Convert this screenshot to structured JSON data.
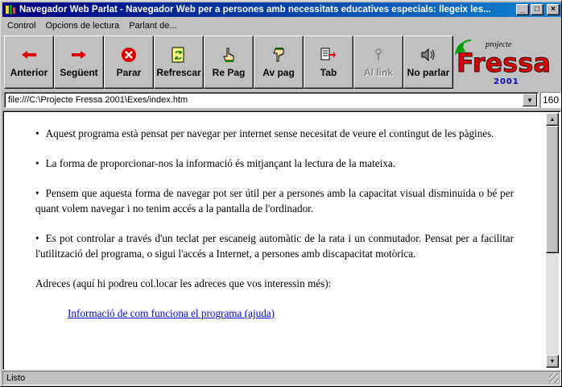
{
  "window": {
    "title": "Navegador Web Parlat - Navegador Web per a persones amb necessitats educatives especials: llegeix les...",
    "controls": {
      "minimize": "_",
      "maximize": "□",
      "close": "×"
    }
  },
  "menu": [
    {
      "label": "Control"
    },
    {
      "label": "Opcions de lectura"
    },
    {
      "label": "Parlant de..."
    }
  ],
  "toolbar": {
    "buttons": [
      {
        "label": "Anterior",
        "icon": "arrow-left-icon",
        "enabled": true
      },
      {
        "label": "Següent",
        "icon": "arrow-right-icon",
        "enabled": true
      },
      {
        "label": "Parar",
        "icon": "stop-icon",
        "enabled": true
      },
      {
        "label": "Refrescar",
        "icon": "refresh-icon",
        "enabled": true
      },
      {
        "label": "Re Pag",
        "icon": "hand-up-icon",
        "enabled": true
      },
      {
        "label": "Av pag",
        "icon": "hand-down-icon",
        "enabled": true
      },
      {
        "label": "Tab",
        "icon": "tab-icon",
        "enabled": true
      },
      {
        "label": "Al link",
        "icon": "link-icon",
        "enabled": false
      },
      {
        "label": "No parlar",
        "icon": "speaker-icon",
        "enabled": true
      }
    ],
    "logo": {
      "top": "projecte",
      "main": "Fressa",
      "year": "2001"
    }
  },
  "address": {
    "value": "file:///C:\\Projecte Fressa 2001\\Exes/index.htm",
    "number": "160"
  },
  "page": {
    "paragraphs": [
      "Aquest programa està pensat per navegar per internet sense necesitat de veure el contingut de les pàgines.",
      "La forma de proporcionar-nos la informació és mitjançant la lectura de la mateixa.",
      "Pensem que aquesta forma de navegar pot ser útil per a persones amb la capacitat visual disminuida o bé per quant volem navegar i no tenim accés a la pantalla de l'ordinador.",
      "Es pot controlar a través d'un teclat per escaneig automàtic de la rata i un conmutador. Pensat per a facilitar l'utilització del programa, o sigui l'accés a Internet, a persones amb discapacitat motòrica."
    ],
    "addresses_label": "Adreces (aquí hi podreu col.locar les adreces que vos interessin més):",
    "link": "Informació de com funciona el programa (ajuda)"
  },
  "status": "Listo",
  "colors": {
    "title_bar": "#000080",
    "link": "#0000ee",
    "face": "#c0c0c0"
  }
}
